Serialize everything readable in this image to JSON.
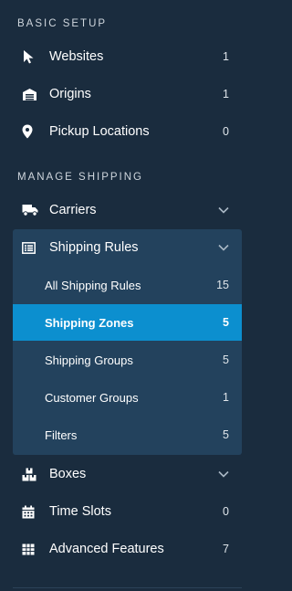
{
  "sections": {
    "basic_setup": "BASIC SETUP",
    "manage_shipping": "MANAGE SHIPPING"
  },
  "items": {
    "websites": {
      "label": "Websites",
      "count": "1",
      "icon": "cursor-arrow-icon"
    },
    "origins": {
      "label": "Origins",
      "count": "1",
      "icon": "warehouse-icon"
    },
    "pickup_locations": {
      "label": "Pickup Locations",
      "count": "0",
      "icon": "map-pin-icon"
    },
    "carriers": {
      "label": "Carriers",
      "icon": "truck-icon"
    },
    "shipping_rules": {
      "label": "Shipping Rules",
      "icon": "list-icon"
    },
    "boxes": {
      "label": "Boxes",
      "icon": "boxes-icon"
    },
    "time_slots": {
      "label": "Time Slots",
      "count": "0",
      "icon": "calendar-icon"
    },
    "advanced_features": {
      "label": "Advanced Features",
      "count": "7",
      "icon": "grid-icon"
    }
  },
  "shipping_rules_sub": [
    {
      "label": "All Shipping Rules",
      "count": "15"
    },
    {
      "label": "Shipping Zones",
      "count": "5",
      "active": true
    },
    {
      "label": "Shipping Groups",
      "count": "5"
    },
    {
      "label": "Customer Groups",
      "count": "1"
    },
    {
      "label": "Filters",
      "count": "5"
    }
  ],
  "colors": {
    "background": "#1a2c3e",
    "group_background": "#23425d",
    "active": "#0c8fcf"
  }
}
